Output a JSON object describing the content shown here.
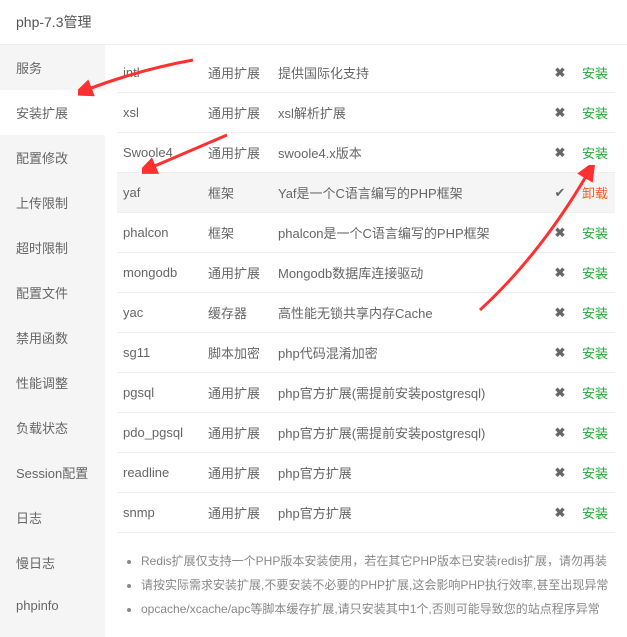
{
  "header": {
    "title": "php-7.3管理"
  },
  "sidebar": {
    "items": [
      {
        "label": "服务",
        "active": false
      },
      {
        "label": "安装扩展",
        "active": true
      },
      {
        "label": "配置修改",
        "active": false
      },
      {
        "label": "上传限制",
        "active": false
      },
      {
        "label": "超时限制",
        "active": false
      },
      {
        "label": "配置文件",
        "active": false
      },
      {
        "label": "禁用函数",
        "active": false
      },
      {
        "label": "性能调整",
        "active": false
      },
      {
        "label": "负载状态",
        "active": false
      },
      {
        "label": "Session配置",
        "active": false
      },
      {
        "label": "日志",
        "active": false
      },
      {
        "label": "慢日志",
        "active": false
      },
      {
        "label": "phpinfo",
        "active": false
      }
    ]
  },
  "extensions": [
    {
      "name": "intl",
      "type": "通用扩展",
      "desc": "提供国际化支持",
      "installed": false,
      "action": "安装"
    },
    {
      "name": "xsl",
      "type": "通用扩展",
      "desc": "xsl解析扩展",
      "installed": false,
      "action": "安装"
    },
    {
      "name": "Swoole4",
      "type": "通用扩展",
      "desc": "swoole4.x版本",
      "installed": false,
      "action": "安装"
    },
    {
      "name": "yaf",
      "type": "框架",
      "desc": "Yaf是一个C语言编写的PHP框架",
      "installed": true,
      "action": "卸载"
    },
    {
      "name": "phalcon",
      "type": "框架",
      "desc": "phalcon是一个C语言编写的PHP框架",
      "installed": false,
      "action": "安装"
    },
    {
      "name": "mongodb",
      "type": "通用扩展",
      "desc": "Mongodb数据库连接驱动",
      "installed": false,
      "action": "安装"
    },
    {
      "name": "yac",
      "type": "缓存器",
      "desc": "高性能无锁共享内存Cache",
      "installed": false,
      "action": "安装"
    },
    {
      "name": "sg11",
      "type": "脚本加密",
      "desc": "php代码混淆加密",
      "installed": false,
      "action": "安装"
    },
    {
      "name": "pgsql",
      "type": "通用扩展",
      "desc": "php官方扩展(需提前安装postgresql)",
      "installed": false,
      "action": "安装"
    },
    {
      "name": "pdo_pgsql",
      "type": "通用扩展",
      "desc": "php官方扩展(需提前安装postgresql)",
      "installed": false,
      "action": "安装"
    },
    {
      "name": "readline",
      "type": "通用扩展",
      "desc": "php官方扩展",
      "installed": false,
      "action": "安装"
    },
    {
      "name": "snmp",
      "type": "通用扩展",
      "desc": "php官方扩展",
      "installed": false,
      "action": "安装"
    }
  ],
  "notes": [
    "Redis扩展仅支持一个PHP版本安装使用，若在其它PHP版本已安装redis扩展，请勿再装",
    "请按实际需求安装扩展,不要安装不必要的PHP扩展,这会影响PHP执行效率,甚至出现异常",
    "opcache/xcache/apc等脚本缓存扩展,请只安装其中1个,否则可能导致您的站点程序异常"
  ]
}
